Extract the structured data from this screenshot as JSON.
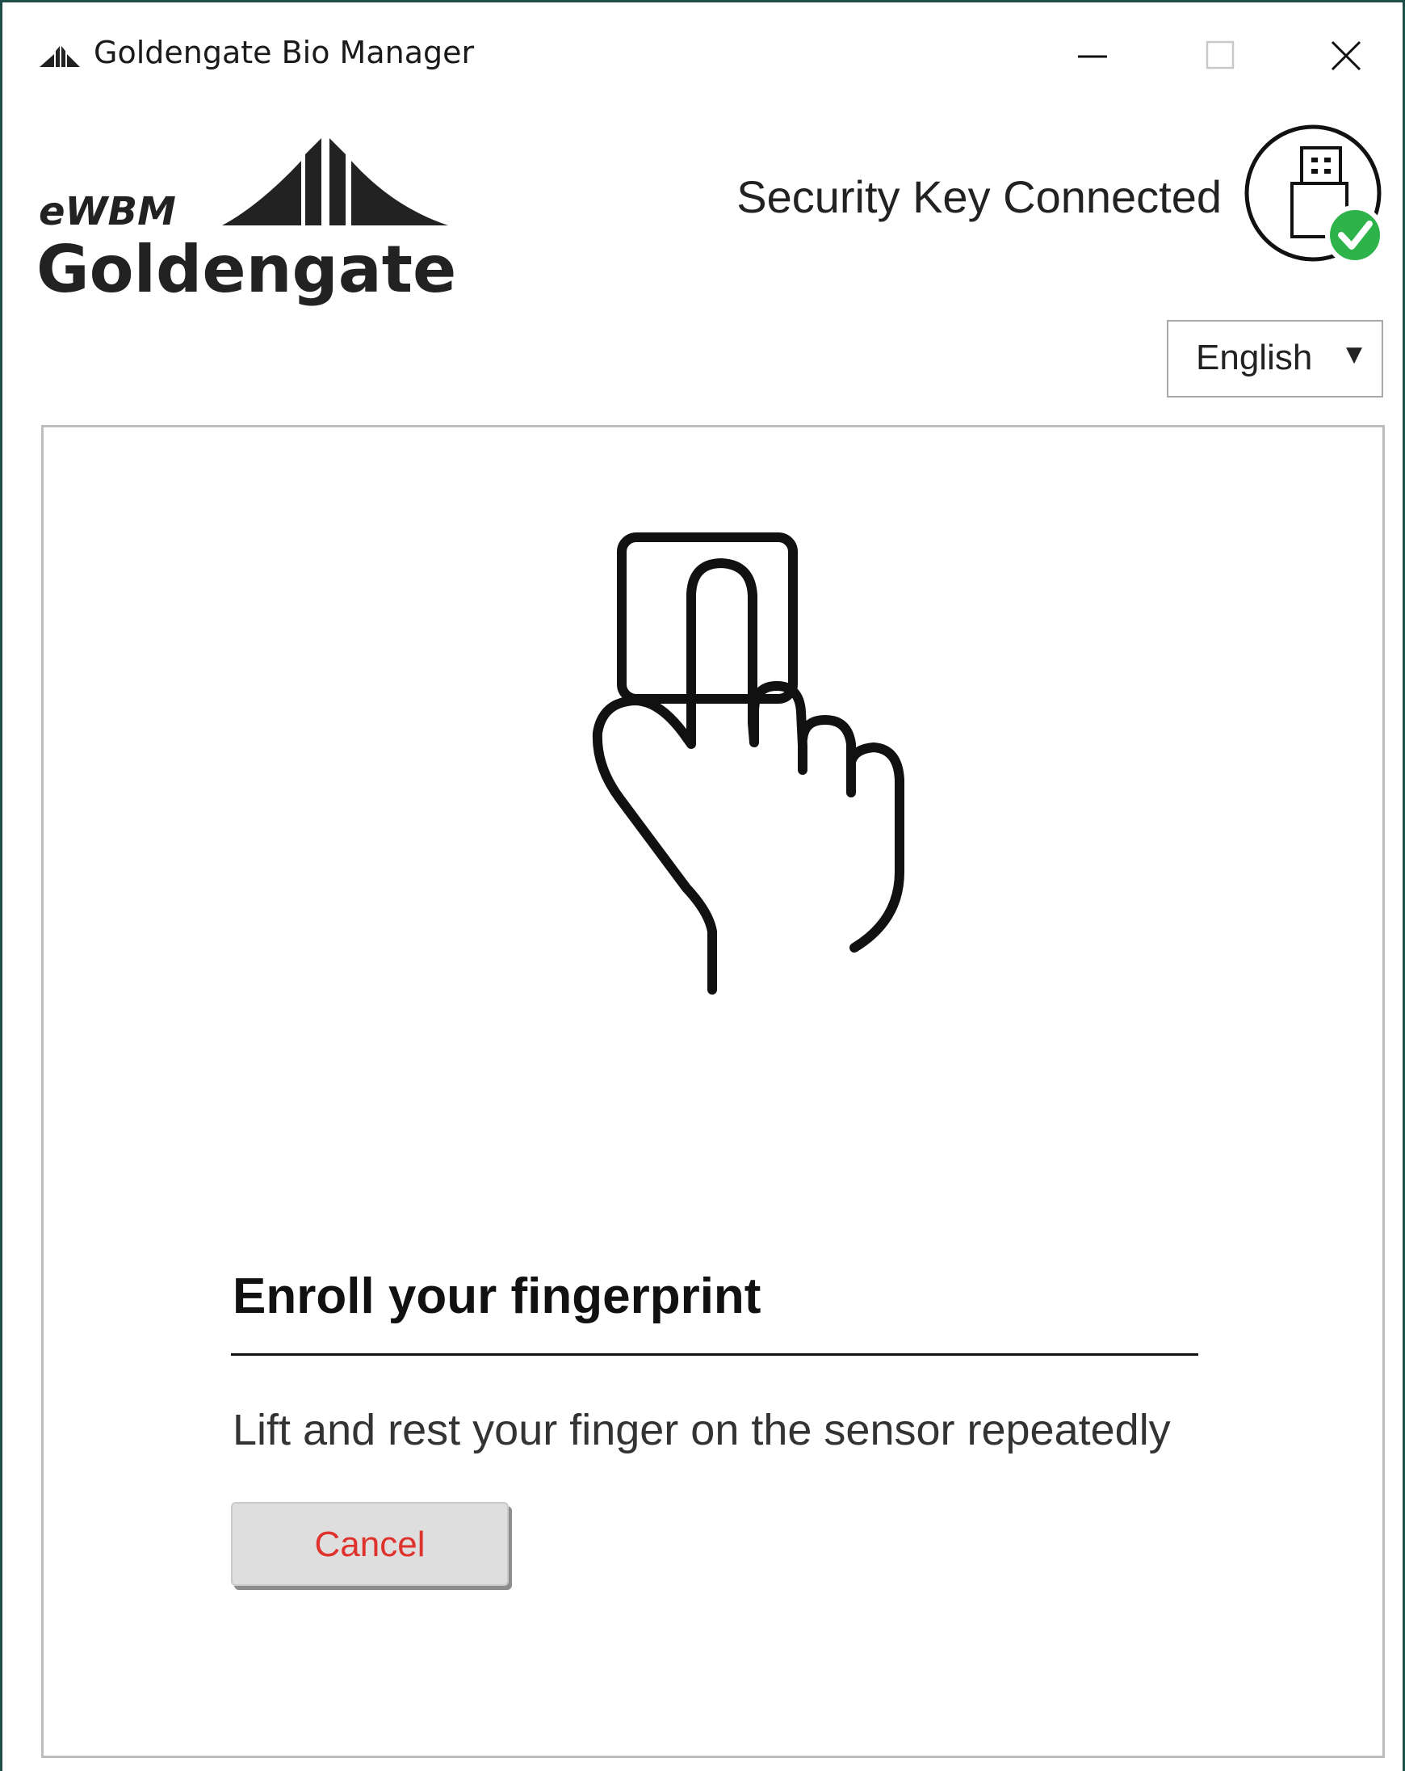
{
  "window": {
    "title": "Goldengate Bio Manager",
    "app_icon": "mountain-logo-icon",
    "controls": {
      "minimize_icon": "minimize-icon",
      "maximize_icon": "maximize-icon",
      "close_icon": "close-icon"
    }
  },
  "header": {
    "logo": {
      "top_text": "eWBM",
      "main_text": "Goldengate"
    },
    "connection_status": "Security Key Connected",
    "connection_icon": "usb-key-connected-icon",
    "status_color": "#2db34a",
    "language": {
      "selected": "English",
      "arrow": "▼"
    }
  },
  "main": {
    "illustration_icon": "finger-touch-sensor-icon",
    "title": "Enroll your fingerprint",
    "instruction": "Lift and rest your finger on the sensor repeatedly",
    "cancel_label": "Cancel",
    "cancel_color": "#e0322c"
  }
}
